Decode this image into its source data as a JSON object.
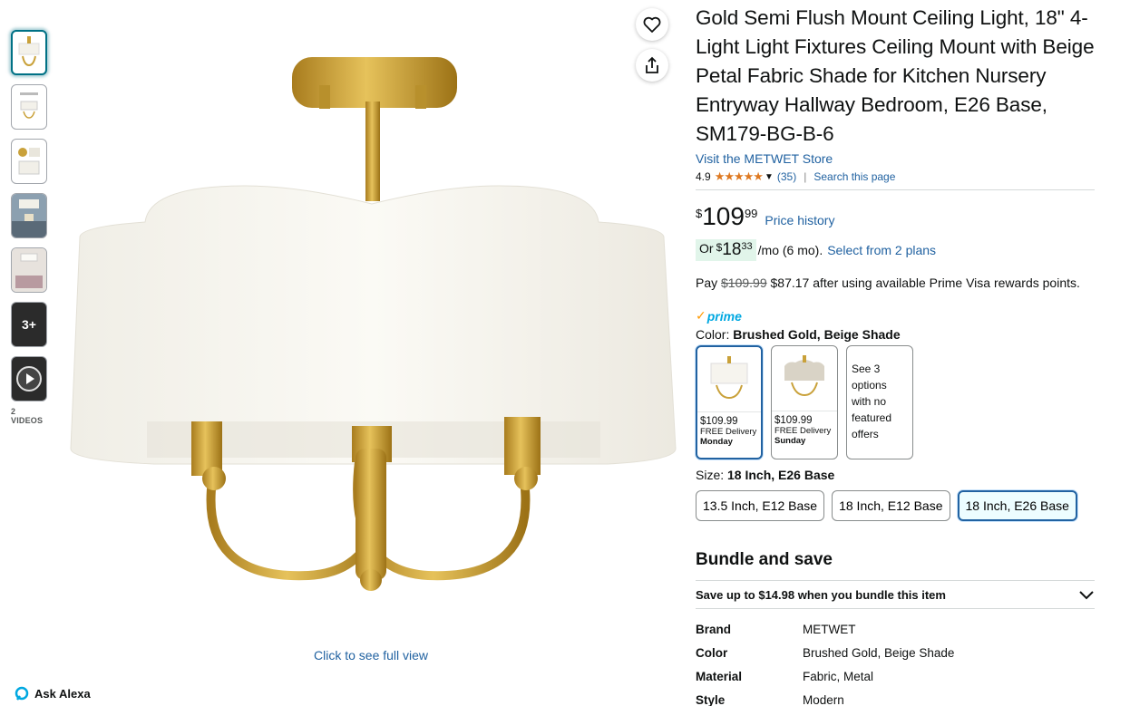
{
  "gallery": {
    "thumbnails": [
      "product-front-icon",
      "dimensions-icon",
      "detail-icon",
      "room-scene-icon",
      "bedroom-scene-icon"
    ],
    "more_count": "3+",
    "videos_label": "2 VIDEOS",
    "click_full_view": "Click to see full view"
  },
  "ask_alexa": "Ask Alexa",
  "product": {
    "title": "Gold Semi Flush Mount Ceiling Light, 18\" 4-Light Light Fixtures Ceiling Mount with Beige Petal Fabric Shade for Kitchen Nursery Entryway Hallway Bedroom, E26 Base, SM179-BG-B-6",
    "store_link": "Visit the METWET Store",
    "rating": "4.9",
    "stars": "★★★★★",
    "reviews": "(35)",
    "search_page": "Search this page",
    "price_symbol": "$",
    "price_whole": "109",
    "price_fraction": "99",
    "price_history": "Price history",
    "monthly": {
      "or": "Or",
      "symbol": "$",
      "whole": "18",
      "fraction": "33",
      "term": "/mo (6 mo).",
      "plans": "Select from 2 plans"
    },
    "pay": {
      "prefix": "Pay",
      "old": "$109.99",
      "rest": "$87.17 after using available Prime Visa rewards points."
    },
    "prime": "prime",
    "color_prefix": "Color:",
    "color_value": "Brushed Gold, Beige Shade",
    "color_options": [
      {
        "price": "$109.99",
        "delivery": "FREE Delivery",
        "day": "Monday"
      },
      {
        "price": "$109.99",
        "delivery": "FREE Delivery",
        "day": "Sunday"
      }
    ],
    "color_more": "See 3 options with no featured offers",
    "size_prefix": "Size:",
    "size_value": "18 Inch, E26 Base",
    "sizes": [
      "13.5 Inch, E12 Base",
      "18 Inch, E12 Base",
      "18 Inch, E26 Base"
    ],
    "bundle_heading": "Bundle and save",
    "bundle_save": "Save up to $14.98 when you bundle this item",
    "specs": [
      {
        "key": "Brand",
        "value": "METWET"
      },
      {
        "key": "Color",
        "value": "Brushed Gold, Beige Shade"
      },
      {
        "key": "Material",
        "value": "Fabric, Metal"
      },
      {
        "key": "Style",
        "value": "Modern"
      }
    ]
  },
  "colors": {
    "link": "#2162a1",
    "star": "#de7921",
    "prime": "#00a8e1",
    "gold": "#c9a13a",
    "shade": "#f6f4ee"
  }
}
